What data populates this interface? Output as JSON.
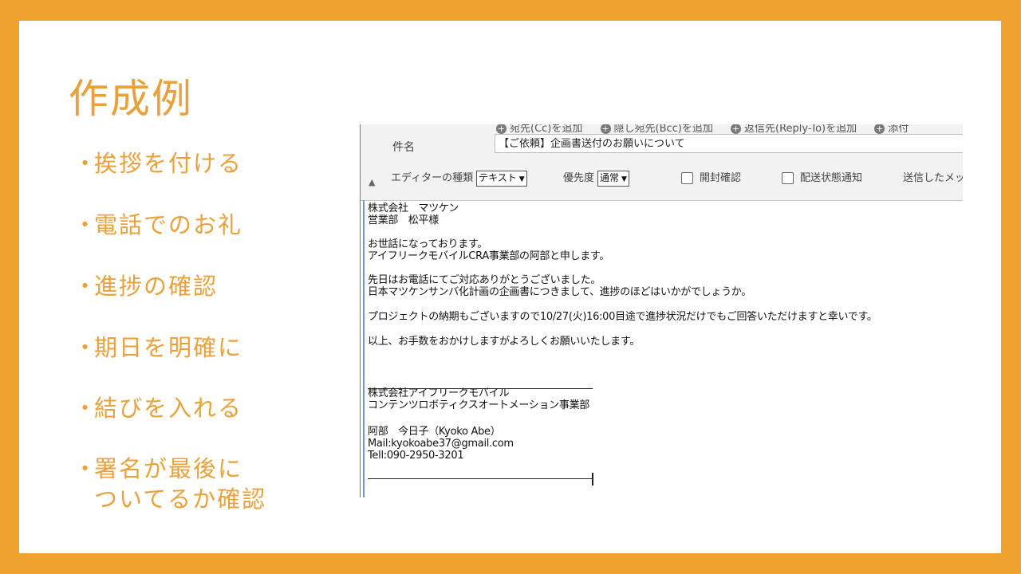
{
  "slide": {
    "title": "作成例",
    "bullets": [
      {
        "lines": [
          "挨拶を付ける"
        ]
      },
      {
        "lines": [
          "電話でのお礼"
        ]
      },
      {
        "lines": [
          "進捗の確認"
        ]
      },
      {
        "lines": [
          "期日を明確に"
        ]
      },
      {
        "lines": [
          "結びを入れる"
        ]
      },
      {
        "lines": [
          "署名が最後に",
          "ついてるか確認"
        ]
      }
    ],
    "bullet_mark": "・"
  },
  "email": {
    "add_buttons": [
      "宛先(Cc)を追加",
      "隠し宛先(Bcc)を追加",
      "返信先(Reply-To)を追加",
      "添付"
    ],
    "subject_label": "件名",
    "subject_value": "【ご依頼】企画書送付のお願いについて",
    "collapse_icon": "▲",
    "editor_type_label": "エディターの種類",
    "editor_type_value": "テキスト",
    "priority_label": "優先度",
    "priority_value": "通常",
    "read_receipt_label": "開封確認",
    "delivery_notice_label": "配送状態通知",
    "sent_mail_label": "送信したメッセ",
    "body_lines": [
      "株式会社　マツケン",
      "営業部　松平様",
      "",
      "お世話になっております。",
      "アイフリークモバイルCRA事業部の阿部と申します。",
      "",
      "先日はお電話にてご対応ありがとうございました。",
      "日本マツケンサンバ化計画の企画書につきまして、進捗のほどはいかがでしょうか。",
      "",
      "プロジェクトの納期もございますので10/27(火)16:00目途で進捗状況だけでもご回答いただけますと幸いです。",
      "",
      "以上、お手数をおかけしますがよろしくお願いいたします。",
      "",
      "",
      "",
      "株式会社アイフリークモバイル",
      "コンテンツロボティクスオートメーション事業部",
      "",
      "阿部　今日子（Kyoko Abe）",
      "Mail:kyokoabe37@gmail.com",
      "Tell:090-2950-3201"
    ]
  },
  "colors": {
    "frame": "#F0A22E",
    "accent_text": "#E9A23B"
  }
}
